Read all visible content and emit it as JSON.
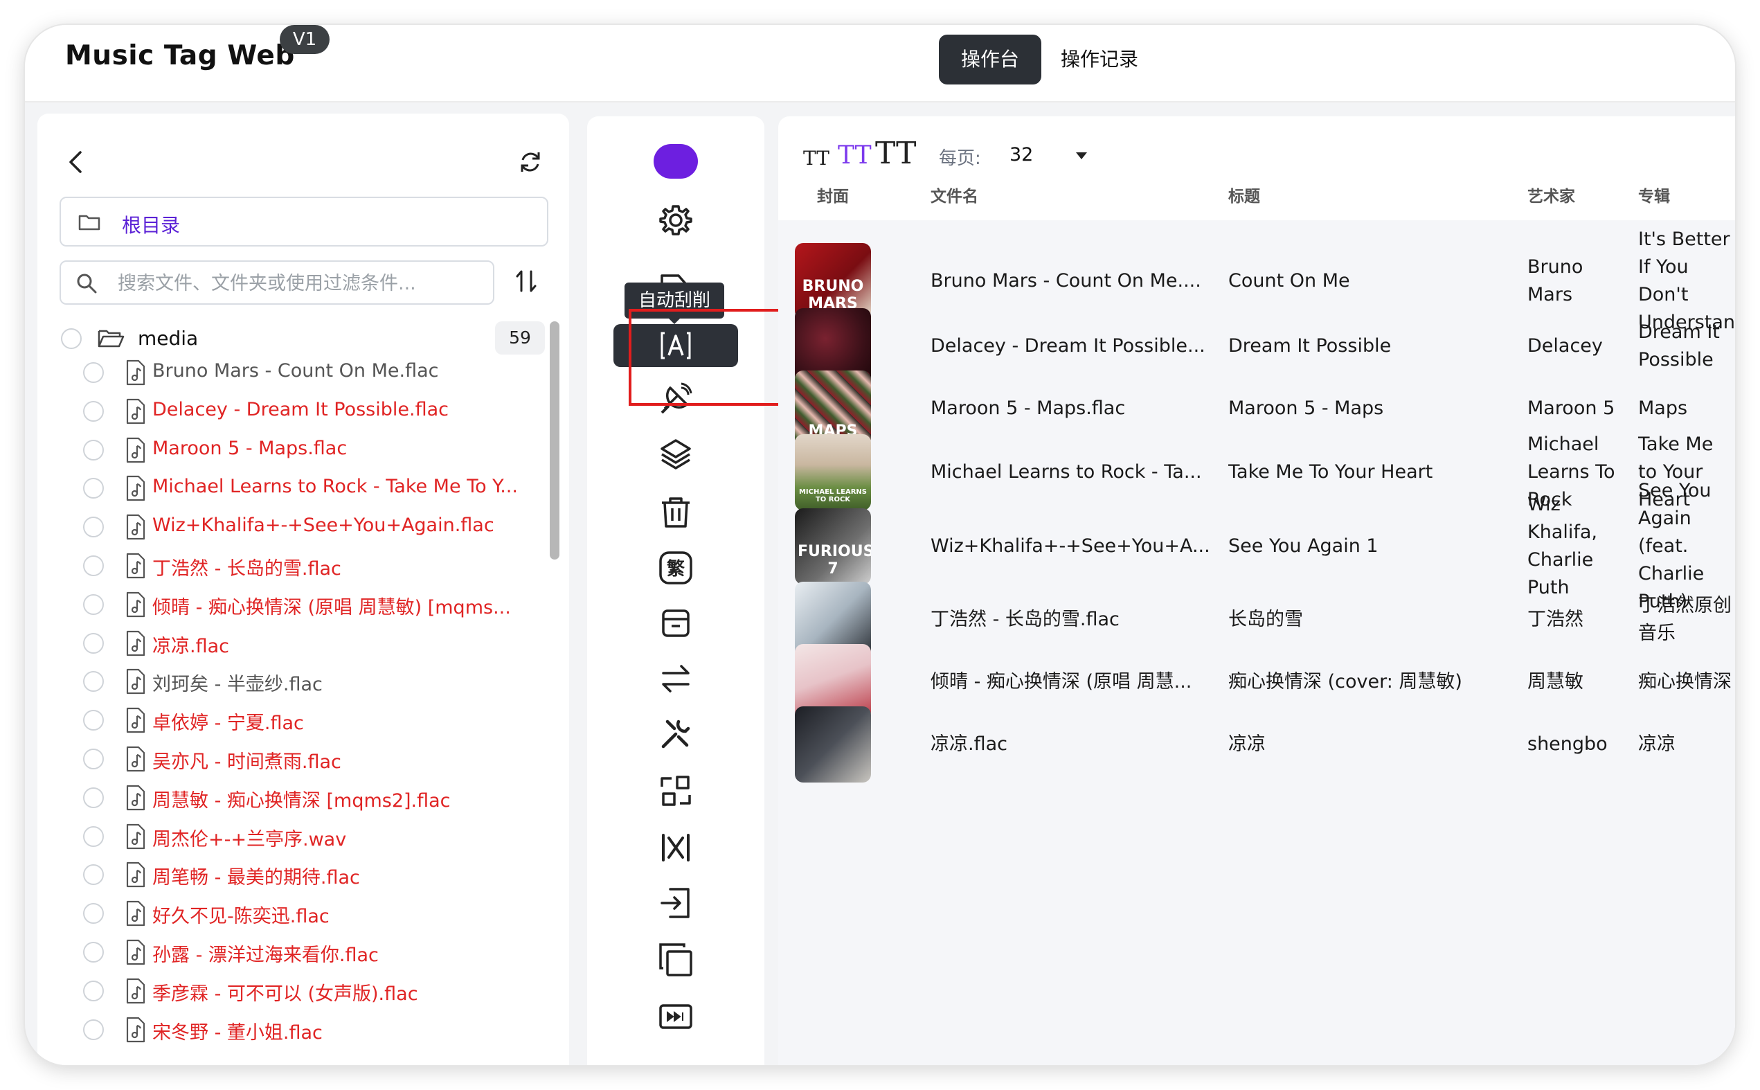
{
  "header": {
    "app_title": "Music Tag Web",
    "version": "V1",
    "tabs": [
      {
        "label": "操作台",
        "active": true
      },
      {
        "label": "操作记录",
        "active": false
      }
    ]
  },
  "sidebar": {
    "root_label": "根目录",
    "search_placeholder": "搜索文件、文件夹或使用过滤条件...",
    "folder": {
      "name": "media",
      "count": "59"
    },
    "files": [
      {
        "name": "Bruno Mars - Count On Me.flac",
        "color": "#555555"
      },
      {
        "name": "Delacey - Dream It Possible.flac",
        "color": "#e02424"
      },
      {
        "name": "Maroon 5 - Maps.flac",
        "color": "#e02424"
      },
      {
        "name": "Michael Learns to Rock - Take Me To Y...",
        "color": "#e02424"
      },
      {
        "name": "Wiz+Khalifa+-+See+You+Again.flac",
        "color": "#e02424"
      },
      {
        "name": "丁浩然 - 长岛的雪.flac",
        "color": "#e02424"
      },
      {
        "name": "倾晴 - 痴心换情深 (原唱 周慧敏) [mqms...",
        "color": "#e02424"
      },
      {
        "name": "凉凉.flac",
        "color": "#e02424"
      },
      {
        "name": "刘珂矣 - 半壶纱.flac",
        "color": "#555555"
      },
      {
        "name": "卓依婷 - 宁夏.flac",
        "color": "#e02424"
      },
      {
        "name": "吴亦凡 - 时间煮雨.flac",
        "color": "#e02424"
      },
      {
        "name": "周慧敏 - 痴心换情深 [mqms2].flac",
        "color": "#e02424"
      },
      {
        "name": "周杰伦+-+兰亭序.wav",
        "color": "#e02424"
      },
      {
        "name": "周笔畅 - 最美的期待.flac",
        "color": "#e02424"
      },
      {
        "name": "好久不见-陈奕迅.flac",
        "color": "#e02424"
      },
      {
        "name": "孙露 - 漂洋过海来看你.flac",
        "color": "#e02424"
      },
      {
        "name": "季彦霖 - 可不可以 (女声版).flac",
        "color": "#e02424"
      },
      {
        "name": "宋冬野 - 董小姐.flac",
        "color": "#e02424"
      }
    ]
  },
  "toolbar": {
    "tooltip": "自动刮削",
    "tools": [
      "gear-icon",
      "tag-icon",
      "auto-scrape-icon",
      "satellite-icon",
      "layers-icon",
      "trash-icon",
      "traditional-icon",
      "archive-icon",
      "swap-icon",
      "wrench-icon",
      "convert-icon",
      "shuffle-icon",
      "import-icon",
      "copy-icon",
      "skip-icon"
    ],
    "accent": "#6d1fe0"
  },
  "table": {
    "font_size_labels": [
      "TT",
      "TT",
      "TT"
    ],
    "per_page_label": "每页:",
    "per_page_value": "32",
    "headers": {
      "cover": "封面",
      "filename": "文件名",
      "title": "标题",
      "artist": "艺术家",
      "album": "专辑"
    },
    "rows": [
      {
        "filename": "Bruno Mars - Count On Me....",
        "title": "Count On Me",
        "artist": "Bruno Mars",
        "album": "It's Better If You Don't Understand",
        "cover_text": "BRUNO MARS"
      },
      {
        "filename": "Delacey - Dream It Possible...",
        "title": "Dream It Possible",
        "artist": "Delacey",
        "album": "Dream It Possible",
        "cover_text": ""
      },
      {
        "filename": "Maroon 5 - Maps.flac",
        "title": "Maroon 5 - Maps",
        "artist": "Maroon 5",
        "album": "Maps",
        "cover_text": "MAPS"
      },
      {
        "filename": "Michael Learns to Rock - Ta...",
        "title": "Take Me To Your Heart",
        "artist": "Michael Learns To Rock",
        "album": "Take Me to Your Heart",
        "cover_text": "MICHAEL LEARNS TO ROCK"
      },
      {
        "filename": "Wiz+Khalifa+-+See+You+A...",
        "title": "See You Again 1",
        "artist": "Wiz Khalifa, Charlie Puth",
        "album": "See You Again (feat. Charlie Puth)",
        "cover_text": "FURIOUS 7"
      },
      {
        "filename": "丁浩然 - 长岛的雪.flac",
        "title": "长岛的雪",
        "artist": "丁浩然",
        "album": "丁浩然原创音乐",
        "cover_text": ""
      },
      {
        "filename": "倾晴 - 痴心换情深 (原唱 周慧...",
        "title": "痴心换情深 (cover: 周慧敏)",
        "artist": "周慧敏",
        "album": "痴心换情深",
        "cover_text": ""
      },
      {
        "filename": "凉凉.flac",
        "title": "凉凉",
        "artist": "shengbo",
        "album": "凉凉",
        "cover_text": ""
      }
    ]
  }
}
